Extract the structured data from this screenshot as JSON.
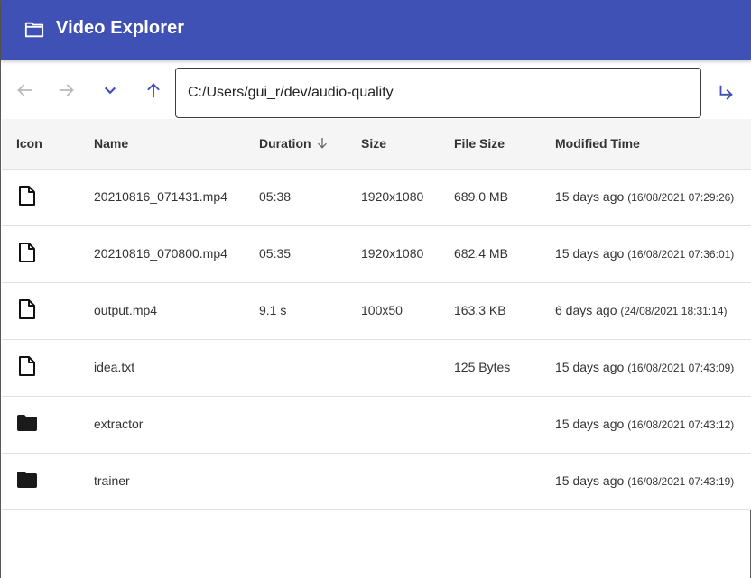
{
  "app": {
    "title": "Video Explorer",
    "icon": "folder-outline-icon",
    "header_color": "#3f51b5",
    "accent_color": "#3f51b5"
  },
  "toolbar": {
    "back_icon": "arrow-left-icon",
    "forward_icon": "arrow-right-icon",
    "dropdown_icon": "chevron-down-icon",
    "up_icon": "arrow-up-icon",
    "path_value": "C:/Users/gui_r/dev/audio-quality",
    "go_icon": "subdirectory-arrow-right-icon"
  },
  "table": {
    "columns": {
      "icon": "Icon",
      "name": "Name",
      "duration": "Duration",
      "size": "Size",
      "file_size": "File Size",
      "modified": "Modified Time"
    },
    "sort": {
      "column": "Duration",
      "direction": "descending",
      "icon": "arrow-down-icon"
    },
    "rows": [
      {
        "type": "file",
        "icon": "file-icon",
        "name": "20210816_071431.mp4",
        "duration": "05:38",
        "size": "1920x1080",
        "file_size": "689.0 MB",
        "modified_rel": "15 days ago",
        "modified_abs": "(16/08/2021 07:29:26)"
      },
      {
        "type": "file",
        "icon": "file-icon",
        "name": "20210816_070800.mp4",
        "duration": "05:35",
        "size": "1920x1080",
        "file_size": "682.4 MB",
        "modified_rel": "15 days ago",
        "modified_abs": "(16/08/2021 07:36:01)"
      },
      {
        "type": "file",
        "icon": "file-icon",
        "name": "output.mp4",
        "duration": "9.1 s",
        "size": "100x50",
        "file_size": "163.3 KB",
        "modified_rel": "6 days ago",
        "modified_abs": "(24/08/2021 18:31:14)"
      },
      {
        "type": "file",
        "icon": "file-icon",
        "name": "idea.txt",
        "duration": "",
        "size": "",
        "file_size": "125 Bytes",
        "modified_rel": "15 days ago",
        "modified_abs": "(16/08/2021 07:43:09)"
      },
      {
        "type": "folder",
        "icon": "folder-icon",
        "name": "extractor",
        "duration": "",
        "size": "",
        "file_size": "",
        "modified_rel": "15 days ago",
        "modified_abs": "(16/08/2021 07:43:12)"
      },
      {
        "type": "folder",
        "icon": "folder-icon",
        "name": "trainer",
        "duration": "",
        "size": "",
        "file_size": "",
        "modified_rel": "15 days ago",
        "modified_abs": "(16/08/2021 07:43:19)"
      }
    ]
  }
}
